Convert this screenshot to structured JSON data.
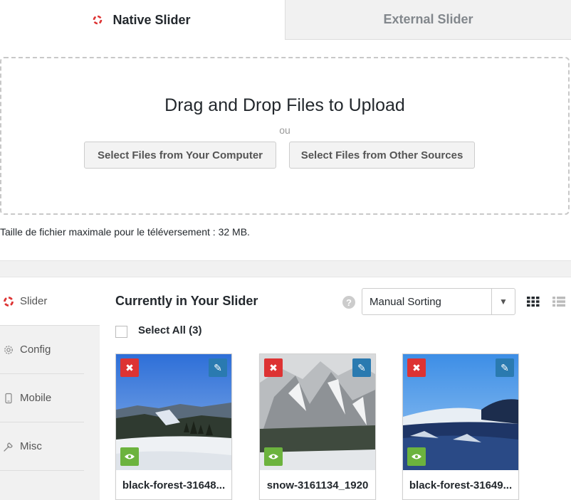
{
  "tabs": {
    "native_label": "Native Slider",
    "external_label": "External Slider"
  },
  "upload": {
    "title": "Drag and Drop Files to Upload",
    "or": "ou",
    "select_computer": "Select Files from Your Computer",
    "select_other": "Select Files from Other Sources",
    "max_size": "Taille de fichier maximale pour le téléversement : 32 MB."
  },
  "sidebar": {
    "items": [
      {
        "label": "Slider",
        "icon": "soliloquy-logo-icon"
      },
      {
        "label": "Config",
        "icon": "gear-icon"
      },
      {
        "label": "Mobile",
        "icon": "mobile-icon"
      },
      {
        "label": "Misc",
        "icon": "wrench-icon"
      }
    ]
  },
  "main": {
    "title": "Currently in Your Slider",
    "help": "?",
    "sort_value": "Manual Sorting",
    "select_all": "Select All (3)"
  },
  "items": [
    {
      "name": "black-forest-31648..."
    },
    {
      "name": "snow-3161134_1920"
    },
    {
      "name": "black-forest-31649..."
    }
  ],
  "colors": {
    "brand": "#dd3333",
    "delete": "#dd3333",
    "edit": "#2a7ab0",
    "view": "#6cb33e"
  }
}
